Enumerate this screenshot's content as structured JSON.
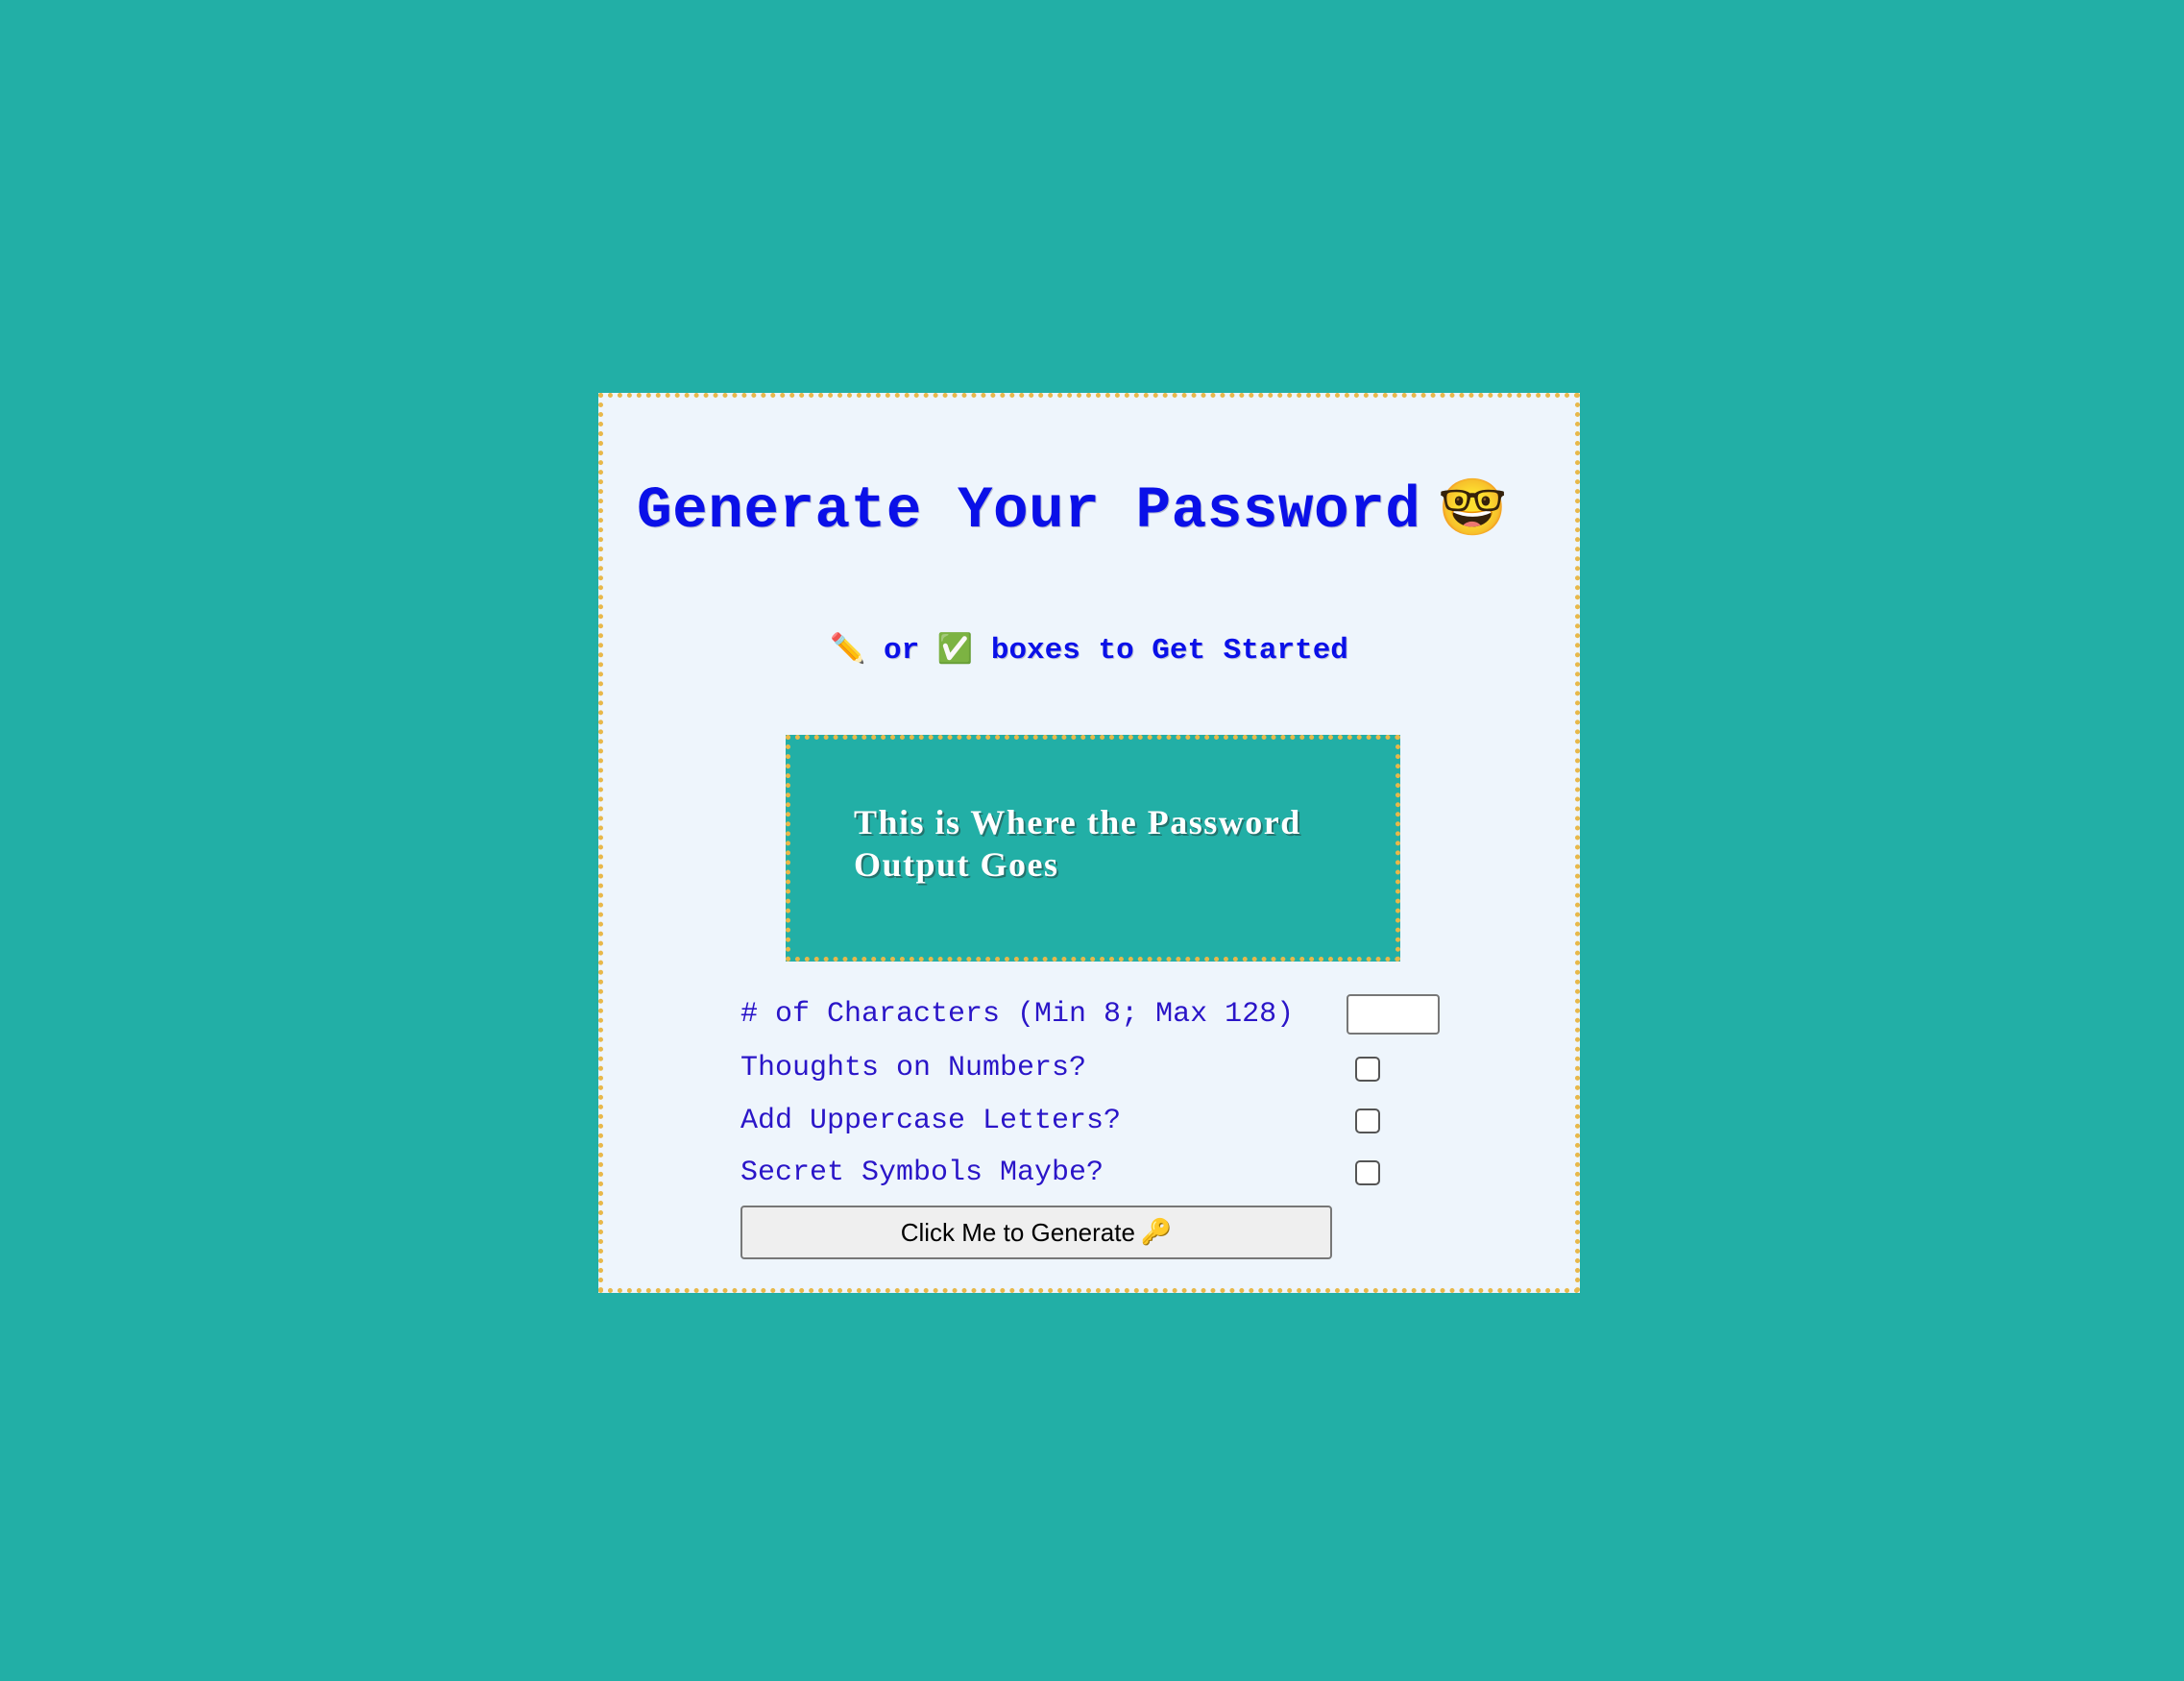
{
  "header": {
    "title": "Generate Your Password",
    "title_emoji": "🤓"
  },
  "subtitle": {
    "pencil_icon": "✏️",
    "text_or": "or",
    "check_icon": "✅",
    "text_rest": "boxes to Get Started"
  },
  "output": {
    "text": "This is Where the Password Output Goes"
  },
  "form": {
    "length_label": "# of Characters (Min 8; Max 128)",
    "length_value": "",
    "numbers_label": "Thoughts on Numbers?",
    "numbers_checked": false,
    "uppercase_label": "Add Uppercase Letters?",
    "uppercase_checked": false,
    "symbols_label": "Secret Symbols Maybe?",
    "symbols_checked": false
  },
  "button": {
    "label": "Click Me to Generate",
    "icon": "🔑"
  },
  "colors": {
    "background": "#22afa6",
    "card": "#eef5fc",
    "border": "#e8b84a",
    "title": "#0a10e8"
  }
}
